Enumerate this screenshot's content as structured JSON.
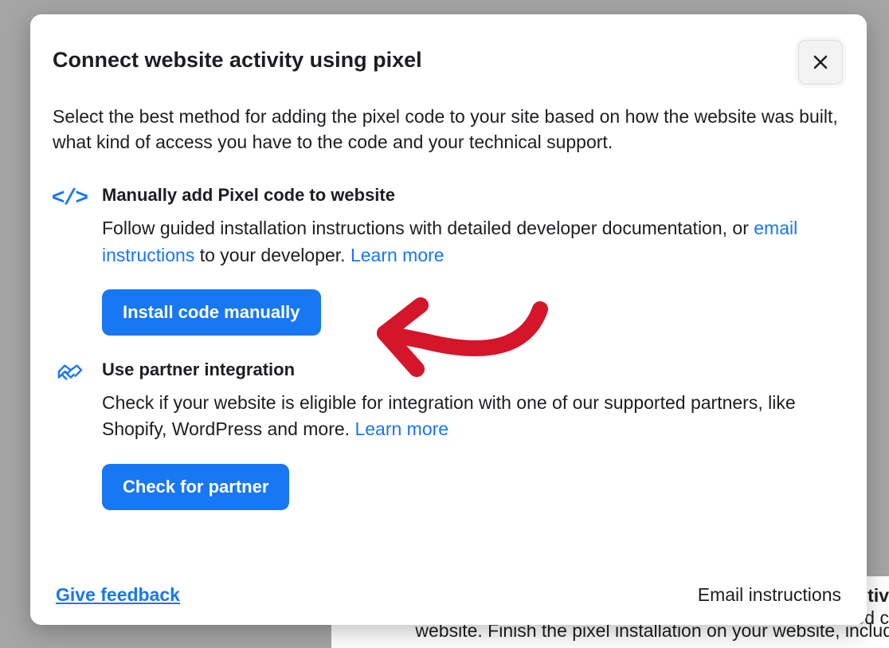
{
  "modal": {
    "title": "Connect website activity using pixel",
    "subtitle": "Select the best method for adding the pixel code to your site based on how the website was built, what kind of access you have to the code and your technical support."
  },
  "options": [
    {
      "title": "Manually add Pixel code to website",
      "desc_prefix": "Follow guided installation instructions with detailed developer documentation, or ",
      "email_link": "email instructions",
      "desc_mid": " to your developer. ",
      "learn_more": "Learn more",
      "button": "Install code manually"
    },
    {
      "title": "Use partner integration",
      "desc_prefix": "Check if your website is eligible for integration with one of our supported partners, like Shopify, WordPress and more. ",
      "learn_more": "Learn more",
      "button": "Check for partner"
    }
  ],
  "footer": {
    "feedback": "Give feedback",
    "email_instructions": "Email instructions"
  },
  "background": {
    "row1": "tiv",
    "row2": "ed c",
    "row3": "website. Finish the pixel installation on your website, includ"
  }
}
